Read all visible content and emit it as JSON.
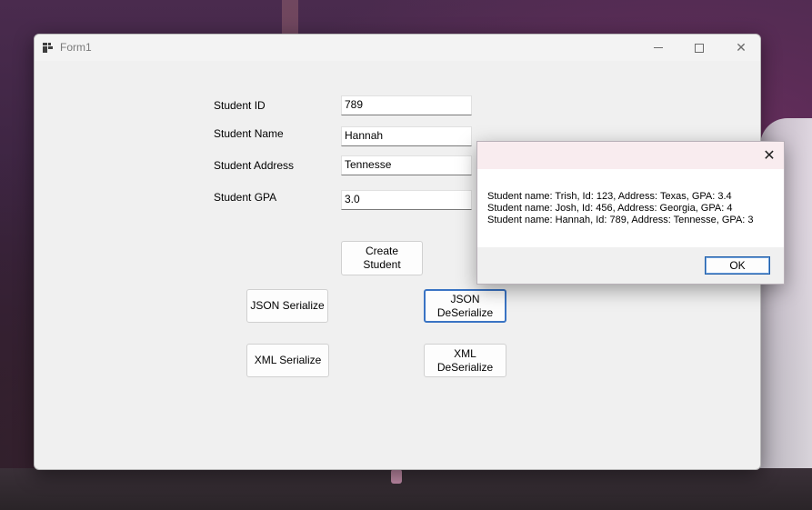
{
  "window": {
    "title": "Form1"
  },
  "form": {
    "student_id_label": "Student ID",
    "student_id_value": "789",
    "student_name_label": "Student Name",
    "student_name_value": "Hannah",
    "student_address_label": "Student Address",
    "student_address_value": "Tennesse",
    "student_gpa_label": "Student GPA",
    "student_gpa_value": "3.0"
  },
  "buttons": {
    "create_student": "Create\nStudent",
    "json_serialize": "JSON Serialize",
    "json_deserialize": "JSON\nDeSerialize",
    "xml_serialize": "XML Serialize",
    "xml_deserialize": "XML\nDeSerialize"
  },
  "message_box": {
    "lines": [
      "Student name: Trish, Id: 123, Address: Texas, GPA: 3.4",
      "Student name: Josh, Id: 456, Address: Georgia, GPA: 4",
      "Student name: Hannah, Id: 789, Address: Tennesse, GPA: 3"
    ],
    "ok_label": "OK",
    "close_glyph": "✕"
  },
  "titlebar_glyphs": {
    "close": "✕"
  },
  "icons": {
    "app": "app-icon",
    "minimize": "minimize-icon",
    "maximize": "maximize-icon",
    "close": "close-icon"
  }
}
